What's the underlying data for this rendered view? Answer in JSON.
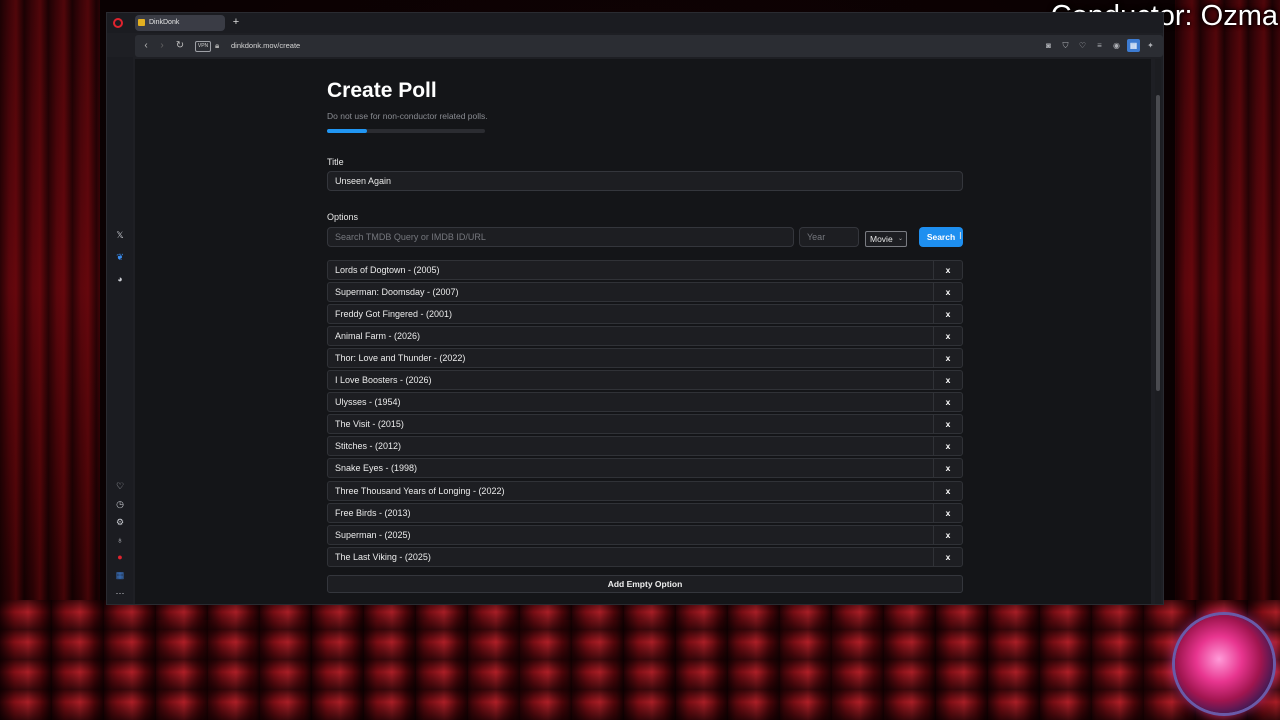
{
  "overlay": {
    "title": "Conductor: Ozma"
  },
  "browser": {
    "tab_title": "DinkDonk",
    "new_tab_glyph": "+",
    "vpn_label": "VPN",
    "url": "dinkdonk.mov/create"
  },
  "page": {
    "heading": "Create Poll",
    "subheading": "Do not use for non-conductor related polls.",
    "progress": 0.25,
    "title_label": "Title",
    "title_value": "Unseen Again",
    "options_label": "Options",
    "search_placeholder": "Search TMDB Query or IMDB ID/URL",
    "year_placeholder": "Year",
    "type_select": "Movie",
    "search_button": "Search",
    "remove_label": "x",
    "options": [
      "Lords of Dogtown - (2005)",
      "Superman: Doomsday - (2007)",
      "Freddy Got Fingered - (2001)",
      "Animal Farm - (2026)",
      "Thor: Love and Thunder - (2022)",
      "I Love Boosters - (2026)",
      "Ulysses - (1954)",
      "The Visit - (2015)",
      "Stitches - (2012)",
      "Snake Eyes - (1998)",
      "Three Thousand Years of Longing - (2022)",
      "Free Birds - (2013)",
      "Superman - (2025)",
      "The Last Viking - (2025)"
    ],
    "add_button": "Add Empty Option"
  },
  "colors": {
    "accent": "#1e8ff0",
    "background": "#141518",
    "opera_red": "#e0232e"
  }
}
